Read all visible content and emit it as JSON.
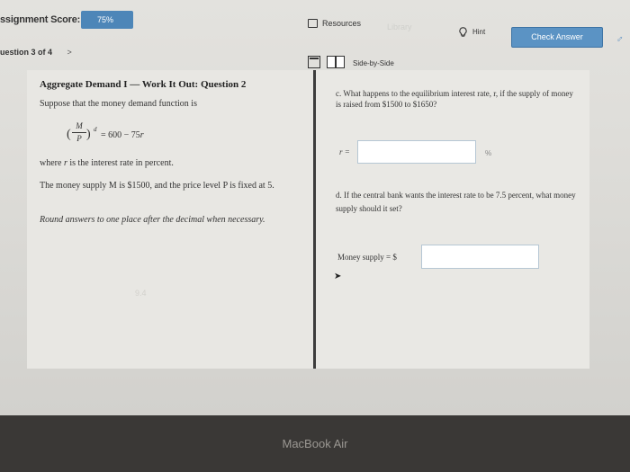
{
  "header": {
    "score_label": "ssignment Score:",
    "score_value": "75%",
    "resources_label": "Resources",
    "ghost_text": "Library",
    "hint_label": "Hint",
    "check_answer_label": "Check Answer",
    "question_nav": "uestion 3 of 4",
    "next_glyph": ">"
  },
  "toolbar": {
    "side_by_side_label": "Side-by-Side"
  },
  "left": {
    "title": "Aggregate Demand I — Work It Out: Question 2",
    "intro": "Suppose that the money demand function is",
    "equation": {
      "numerator": "M",
      "denominator": "P",
      "superscript": "d",
      "rhs_prefix": "= 600 − 75",
      "rhs_var": "r"
    },
    "rate_prefix": "where ",
    "rate_var": "r",
    "rate_suffix": " is the interest rate in percent.",
    "supply_text": "The money supply M is $1500, and the price level P is fixed at 5.",
    "round_text": "Round answers to one place after the decimal when necessary.",
    "faint_text": "9.4"
  },
  "right": {
    "part_c": "c. What happens to the equilibrium interest rate, r, if the supply of money is raised from $1500 to $1650?",
    "r_label": "r =",
    "r_value": "",
    "percent_unit": "%",
    "part_d": "d. If the central bank wants the interest rate to be 7.5 percent, what money supply should it set?",
    "money_label": "Money supply = $",
    "money_value": "",
    "cursor_glyph": "➤"
  },
  "device": {
    "label": "MacBook Air"
  },
  "colors": {
    "accent_blue": "#5b93c4",
    "score_blue": "#4d86b8"
  }
}
